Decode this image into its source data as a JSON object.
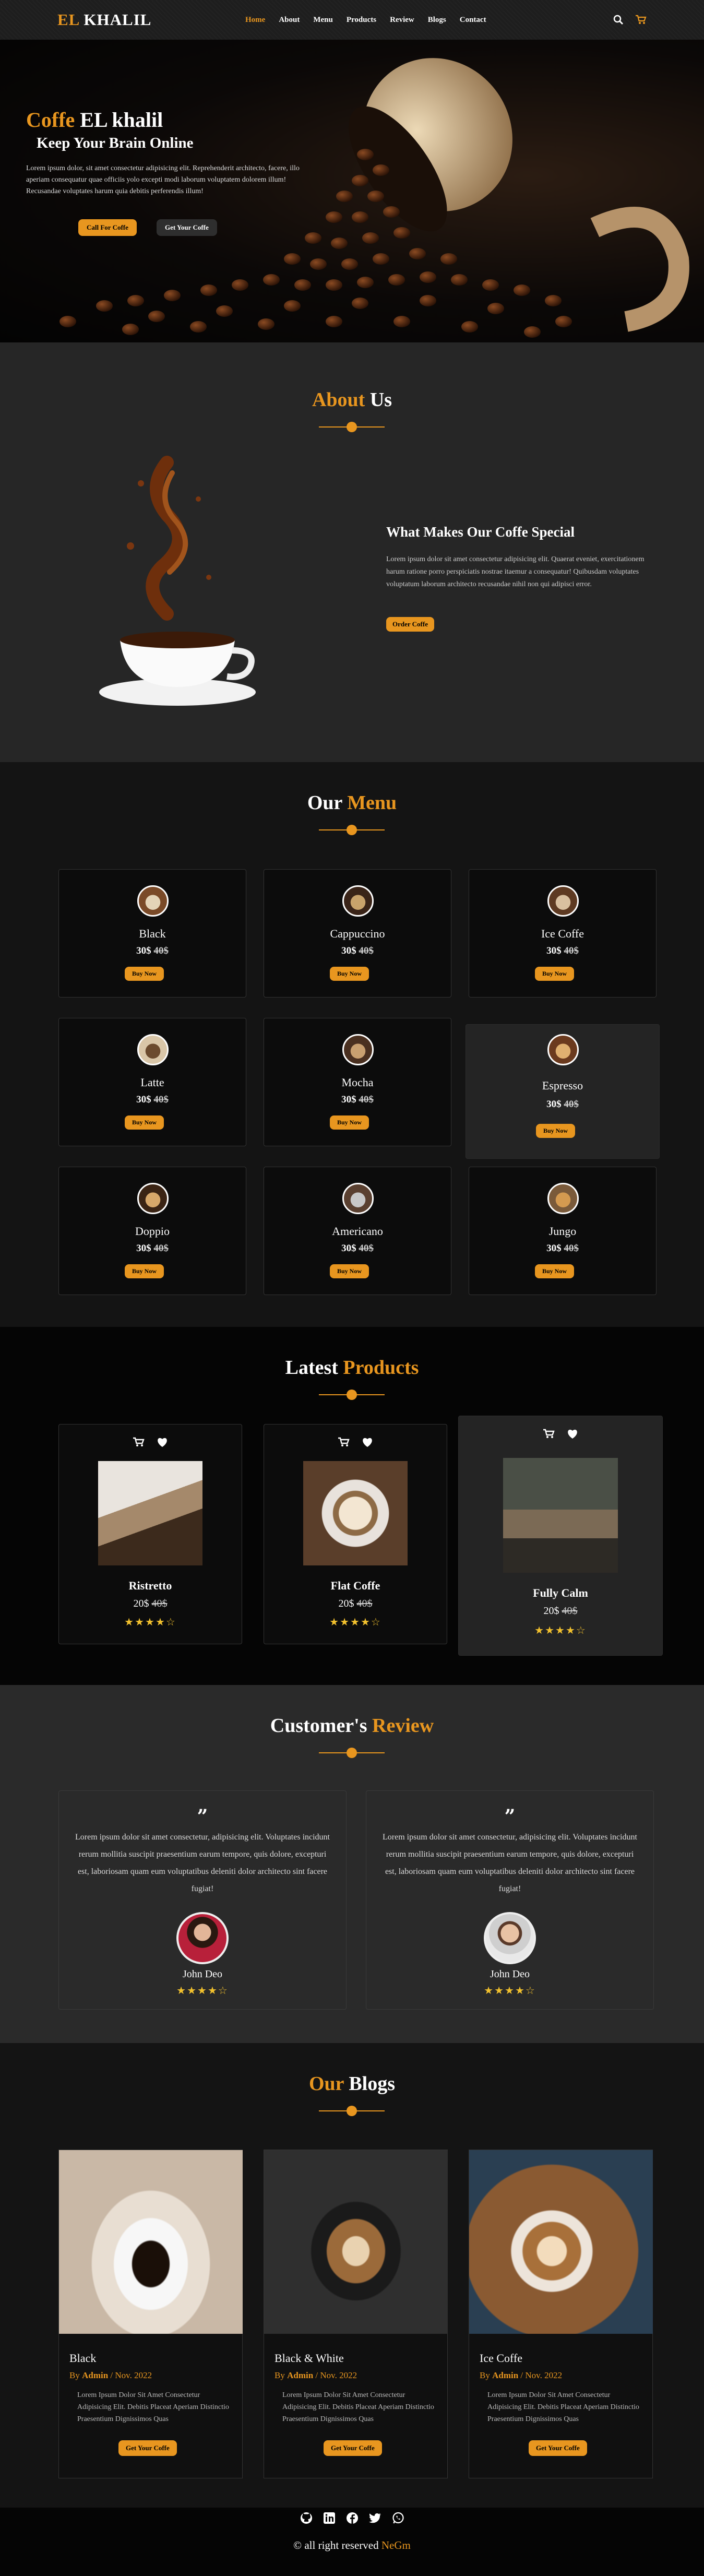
{
  "nav": {
    "logo_a": "EL",
    "logo_b": " KHALIL",
    "links": [
      "Home",
      "About",
      "Menu",
      "Products",
      "Review",
      "Blogs",
      "Contact"
    ],
    "icons": [
      "search-icon",
      "cart-icon"
    ]
  },
  "hero": {
    "title_a": "Coffe",
    "title_b": " EL khalil",
    "subtitle": "Keep Your Brain Online",
    "text": "Lorem ipsum dolor, sit amet consectetur adipisicing elit. Reprehenderit architecto, facere, illo aperiam consequatur quae officiis yolo excepti modi laborum voluptatem dolorem illum! Recusandae voluptates harum quia debitis perferendis illum!",
    "btn_primary": "Call For Coffe",
    "btn_secondary": "Get Your Coffe"
  },
  "about": {
    "title_a": "About",
    "title_b": " Us",
    "heading": "What Makes Our Coffe Special",
    "text": "Lorem ipsum dolor sit amet consectetur adipisicing elit. Quaerat eveniet, exercitationem harum ratione porro perspiciatis nostrae itaemur a consequatur! Quibusdam voluptates voluptatum laborum architecto recusandae nihil non qui adipisci error.",
    "button": "Order Coffe"
  },
  "menu": {
    "title_a": "Our",
    "title_b": " Menu",
    "buy_label": "Buy Now",
    "items": [
      {
        "name": "Black",
        "price": "30$",
        "old": "40$"
      },
      {
        "name": "Cappuccino",
        "price": "30$",
        "old": "40$"
      },
      {
        "name": "Ice Coffe",
        "price": "30$",
        "old": "40$"
      },
      {
        "name": "Latte",
        "price": "30$",
        "old": "40$"
      },
      {
        "name": "Mocha",
        "price": "30$",
        "old": "40$"
      },
      {
        "name": "Espresso",
        "price": "30$",
        "old": "40$"
      },
      {
        "name": "Doppio",
        "price": "30$",
        "old": "40$"
      },
      {
        "name": "Americano",
        "price": "30$",
        "old": "40$"
      },
      {
        "name": "Jungo",
        "price": "30$",
        "old": "40$"
      }
    ]
  },
  "products": {
    "title_a": "Latest",
    "title_b": " Products",
    "items": [
      {
        "name": "Ristretto",
        "price": "20$",
        "old": "40$",
        "rating": 4
      },
      {
        "name": "Flat Coffe",
        "price": "20$",
        "old": "40$",
        "rating": 4
      },
      {
        "name": "Fully Calm",
        "price": "20$",
        "old": "40$",
        "rating": 4
      }
    ]
  },
  "review": {
    "title_a": "Customer's",
    "title_b": " Review",
    "quote_mark": "”",
    "items": [
      {
        "text": "Lorem ipsum dolor sit amet consectetur, adipisicing elit. Voluptates incidunt rerum mollitia suscipit praesentium earum tempore, quis dolore, excepturi est, laboriosam quam eum voluptatibus deleniti dolor architecto sint facere fugiat!",
        "name": "John Deo",
        "rating": 4
      },
      {
        "text": "Lorem ipsum dolor sit amet consectetur, adipisicing elit. Voluptates incidunt rerum mollitia suscipit praesentium earum tempore, quis dolore, excepturi est, laboriosam quam eum voluptatibus deleniti dolor architecto sint facere fugiat!",
        "name": "John Deo",
        "rating": 4
      }
    ]
  },
  "blogs": {
    "title_a": "Our",
    "title_b": " Blogs",
    "button": "Get Your Coffe",
    "by": "By ",
    "items": [
      {
        "title": "Black",
        "author": "Admin",
        "date": "Nov. 2022",
        "desc": "Lorem Ipsum Dolor Sit Amet Consectetur Adipisicing Elit. Debitis Placeat Aperiam Distinctio Praesentium Dignissimos Quas"
      },
      {
        "title": "Black & White",
        "author": "Admin",
        "date": "Nov. 2022",
        "desc": "Lorem Ipsum Dolor Sit Amet Consectetur Adipisicing Elit. Debitis Placeat Aperiam Distinctio Praesentium Dignissimos Quas"
      },
      {
        "title": "Ice Coffe",
        "author": "Admin",
        "date": "Nov. 2022",
        "desc": "Lorem Ipsum Dolor Sit Amet Consectetur Adipisicing Elit. Debitis Placeat Aperiam Distinctio Praesentium Dignissimos Quas"
      }
    ]
  },
  "footer": {
    "icons": [
      "github-icon",
      "linkedin-icon",
      "facebook-icon",
      "twitter-icon",
      "whatsapp-icon"
    ],
    "copy": "© all right reserved ",
    "author": "NeGm"
  },
  "colors": {
    "accent": "#e8961f",
    "star": "#f2c12e"
  }
}
